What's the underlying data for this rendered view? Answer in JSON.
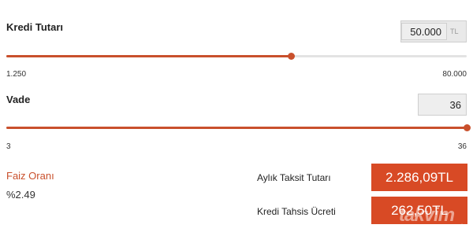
{
  "loan_amount": {
    "label": "Kredi Tutarı",
    "value": "50.000",
    "unit": "TL",
    "min_label": "1.250",
    "max_label": "80.000",
    "slider_fraction": 0.618
  },
  "term": {
    "label": "Vade",
    "value": "36",
    "min_label": "3",
    "max_label": "36",
    "slider_fraction": 1.0
  },
  "interest": {
    "label": "Faiz Oranı",
    "value": "%2.49"
  },
  "results": {
    "monthly_label": "Aylık Taksit Tutarı",
    "monthly_value": "2.286,09TL",
    "fee_label": "Kredi Tahsis Ücreti",
    "fee_value": "262,50TL"
  },
  "watermark": {
    "text": "takvim",
    "suffix": ".com.tr"
  },
  "colors": {
    "accent": "#c9502c",
    "button": "#d84a25",
    "interest_label": "#c9502c"
  }
}
